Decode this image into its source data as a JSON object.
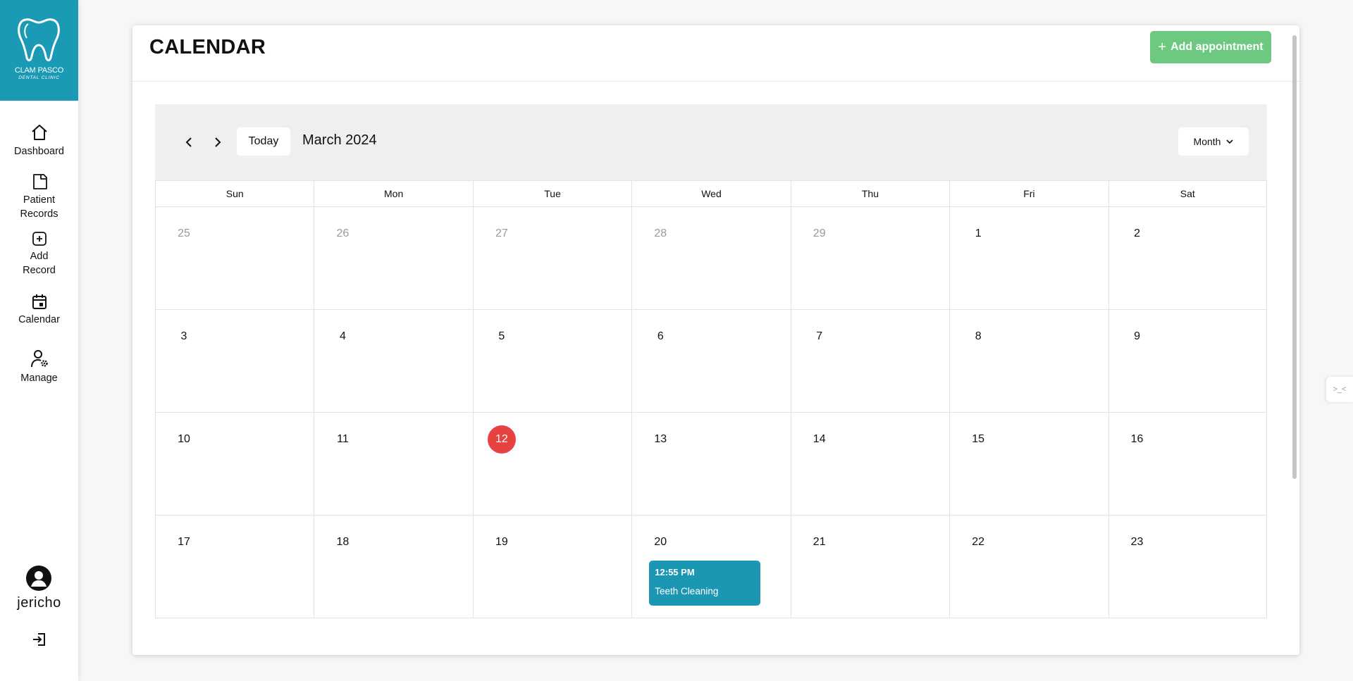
{
  "clinic": {
    "name": "CLAM PASCO",
    "subtitle": "DENTAL CLINIC",
    "brand_color": "#1b9ab6"
  },
  "sidebar": {
    "items": [
      {
        "label": "Dashboard",
        "icon": "home-icon"
      },
      {
        "label": "Patient Records",
        "icon": "folder-icon"
      },
      {
        "label": "Add Record",
        "icon": "plus-square-icon"
      },
      {
        "label": "Calendar",
        "icon": "calendar-icon"
      },
      {
        "label": "Manage",
        "icon": "user-gear-icon"
      }
    ],
    "user": {
      "name": "jericho"
    }
  },
  "header": {
    "title": "CALENDAR",
    "add_button": "Add appointment",
    "add_color": "#6cc97f"
  },
  "calendar": {
    "today_label": "Today",
    "month_label": "March 2024",
    "view": "Month",
    "weekdays": [
      "Sun",
      "Mon",
      "Tue",
      "Wed",
      "Thu",
      "Fri",
      "Sat"
    ],
    "weeks": [
      [
        {
          "n": "25",
          "other": true
        },
        {
          "n": "26",
          "other": true
        },
        {
          "n": "27",
          "other": true
        },
        {
          "n": "28",
          "other": true
        },
        {
          "n": "29",
          "other": true
        },
        {
          "n": "1"
        },
        {
          "n": "2"
        }
      ],
      [
        {
          "n": "3"
        },
        {
          "n": "4"
        },
        {
          "n": "5"
        },
        {
          "n": "6"
        },
        {
          "n": "7"
        },
        {
          "n": "8"
        },
        {
          "n": "9"
        }
      ],
      [
        {
          "n": "10"
        },
        {
          "n": "11"
        },
        {
          "n": "12",
          "today": true
        },
        {
          "n": "13"
        },
        {
          "n": "14"
        },
        {
          "n": "15"
        },
        {
          "n": "16"
        }
      ],
      [
        {
          "n": "17"
        },
        {
          "n": "18"
        },
        {
          "n": "19"
        },
        {
          "n": "20",
          "event": {
            "time": "12:55 PM",
            "title": "Teeth Cleaning"
          }
        },
        {
          "n": "21"
        },
        {
          "n": "22"
        },
        {
          "n": "23"
        }
      ]
    ],
    "today_color": "#e84141",
    "event_color": "#1b97b4"
  },
  "side_tab": {
    "label": ">_<"
  }
}
